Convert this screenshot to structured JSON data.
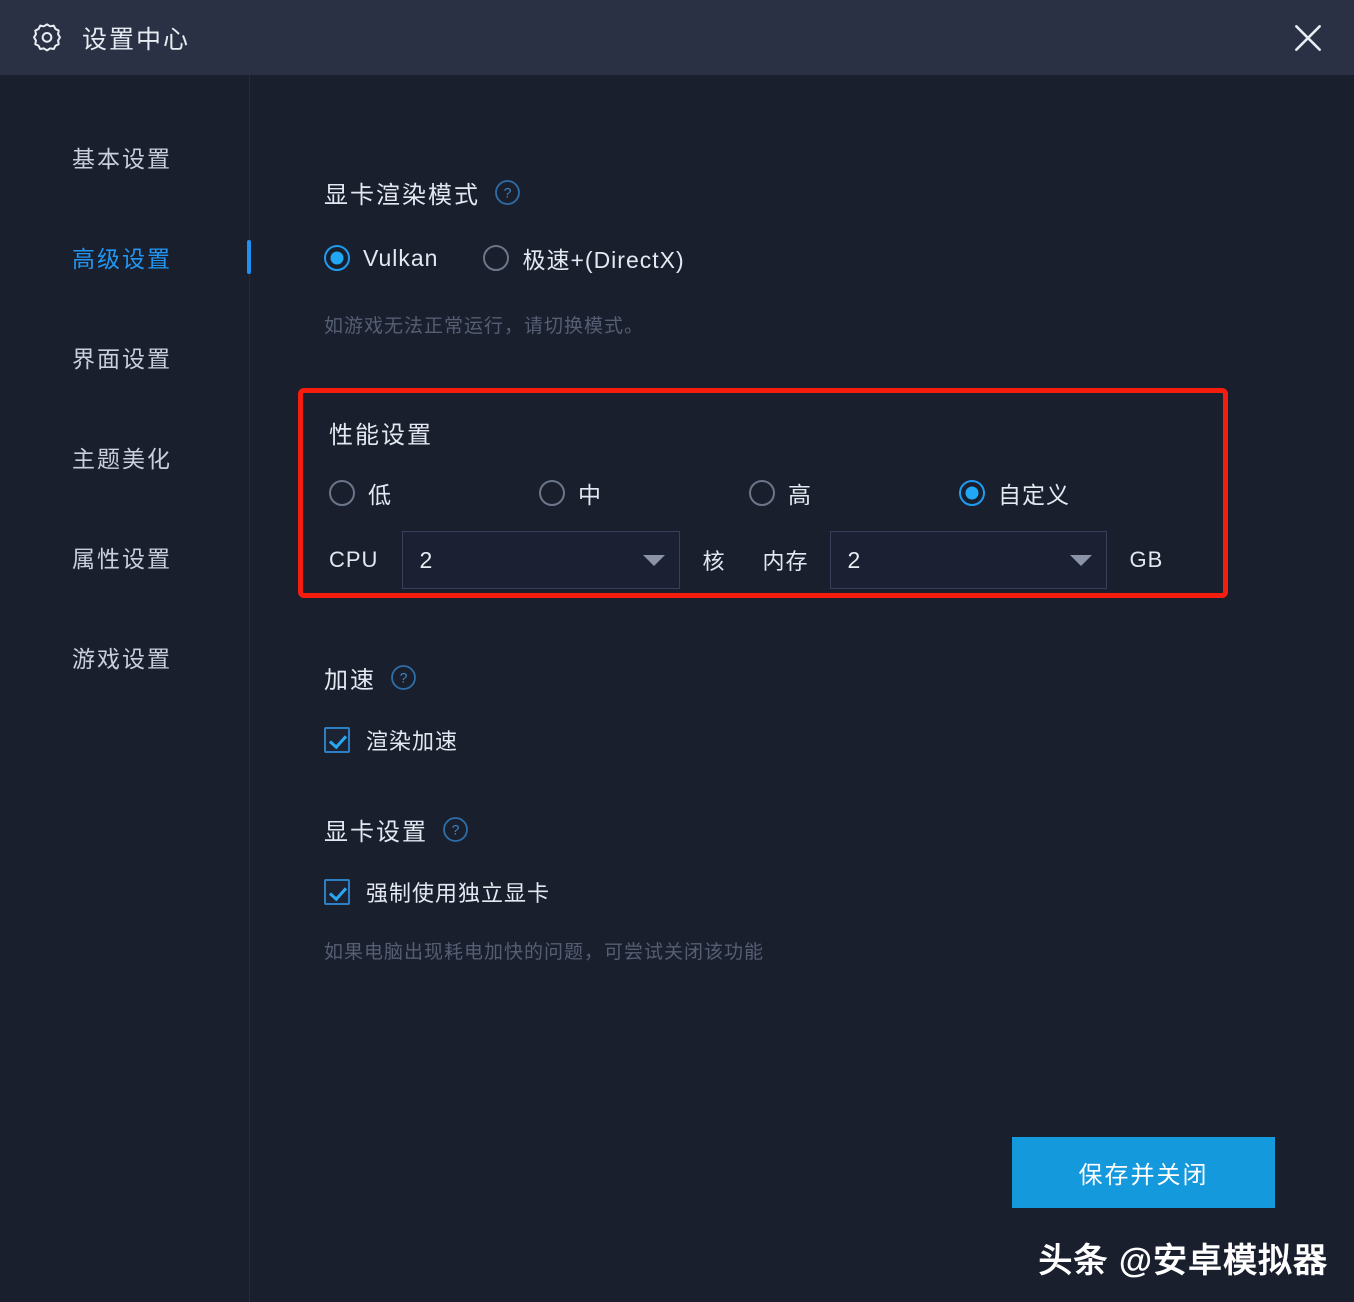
{
  "titlebar": {
    "icon": "gear-icon",
    "title": "设置中心",
    "close_icon": "close-icon"
  },
  "sidebar": {
    "items": [
      {
        "label": "基本设置",
        "active": false
      },
      {
        "label": "高级设置",
        "active": true
      },
      {
        "label": "界面设置",
        "active": false
      },
      {
        "label": "主题美化",
        "active": false
      },
      {
        "label": "属性设置",
        "active": false
      },
      {
        "label": "游戏设置",
        "active": false
      }
    ]
  },
  "render_mode": {
    "title": "显卡渲染模式",
    "help_icon": "help-icon",
    "options": [
      {
        "label": "Vulkan",
        "checked": true
      },
      {
        "label": "极速+(DirectX)",
        "checked": false
      }
    ],
    "hint": "如游戏无法正常运行，请切换模式。"
  },
  "performance": {
    "title": "性能设置",
    "highlight_color": "#f51d0d",
    "options": [
      {
        "label": "低",
        "checked": false
      },
      {
        "label": "中",
        "checked": false
      },
      {
        "label": "高",
        "checked": false
      },
      {
        "label": "自定义",
        "checked": true
      }
    ],
    "cpu": {
      "label": "CPU",
      "value": "2",
      "unit": "核"
    },
    "memory": {
      "label": "内存",
      "value": "2",
      "unit": "GB"
    }
  },
  "acceleration": {
    "title": "加速",
    "help_icon": "help-icon",
    "checkbox": {
      "label": "渲染加速",
      "checked": true
    }
  },
  "gpu_settings": {
    "title": "显卡设置",
    "help_icon": "help-icon",
    "checkbox": {
      "label": "强制使用独立显卡",
      "checked": true
    },
    "hint": "如果电脑出现耗电加快的问题，可尝试关闭该功能"
  },
  "footer": {
    "save_label": "保存并关闭",
    "save_color": "#1499dd",
    "watermark": "头条 @安卓模拟器"
  }
}
